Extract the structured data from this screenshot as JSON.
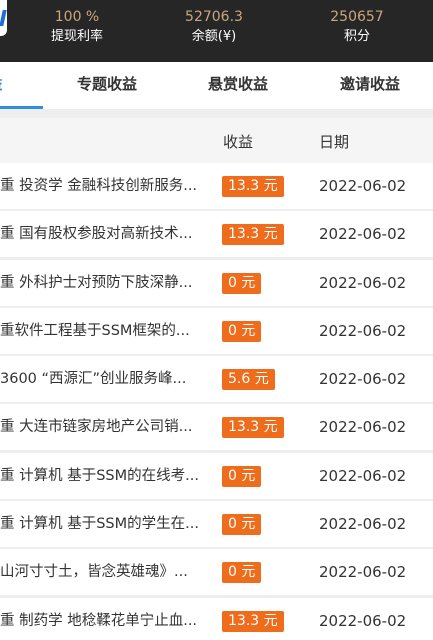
{
  "header": {
    "stats": [
      {
        "value": "100 %",
        "label": "提现利率"
      },
      {
        "value": "52706.3",
        "label": "余额(¥)"
      },
      {
        "value": "250657",
        "label": "积分"
      }
    ]
  },
  "tabs": [
    {
      "label": "益"
    },
    {
      "label": "专题收益"
    },
    {
      "label": "悬赏收益"
    },
    {
      "label": "邀请收益"
    }
  ],
  "table": {
    "headers": {
      "earnings": "收益",
      "date": "日期"
    },
    "rows": [
      {
        "name": "重 投资学 金融科技创新服务...",
        "amount": "13.3 元",
        "date": "2022-06-02"
      },
      {
        "name": "重 国有股权参股对高新技术...",
        "amount": "13.3 元",
        "date": "2022-06-02"
      },
      {
        "name": "重 外科护士对预防下肢深静...",
        "amount": "0 元",
        "date": "2022-06-02"
      },
      {
        "name": "重软件工程基于SSM框架的...",
        "amount": "0 元",
        "date": "2022-06-02"
      },
      {
        "name": "3600 “西源汇”创业服务峰...",
        "amount": "5.6 元",
        "date": "2022-06-02"
      },
      {
        "name": "重 大连市链家房地产公司销...",
        "amount": "13.3 元",
        "date": "2022-06-02"
      },
      {
        "name": "重 计算机 基于SSM的在线考...",
        "amount": "0 元",
        "date": "2022-06-02"
      },
      {
        "name": "重 计算机 基于SSM的学生在...",
        "amount": "0 元",
        "date": "2022-06-02"
      },
      {
        "name": "山河寸寸土，皆念英雄魂》...",
        "amount": "0 元",
        "date": "2022-06-02"
      },
      {
        "name": "重 制药学 地稔鞣花单宁止血...",
        "amount": "13.3 元",
        "date": "2022-06-02"
      }
    ]
  }
}
